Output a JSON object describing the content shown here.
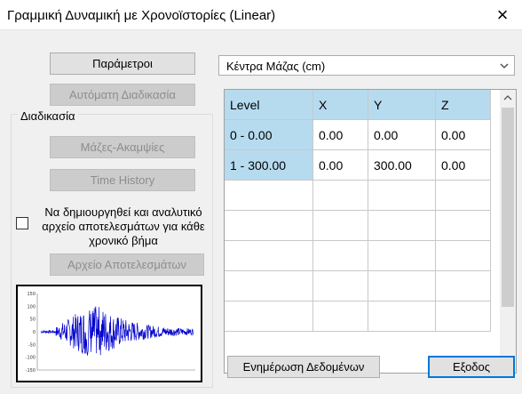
{
  "window": {
    "title": "Γραμμική Δυναμική με Χρονοϊστορίες (Linear)",
    "close_glyph": "×"
  },
  "left_panel": {
    "parameters_label": "Παράμετροι",
    "auto_process_label": "Αυτόματη Διαδικασία",
    "group_label": "Διαδικασία",
    "masses_label": "Μάζες-Ακαμψίες",
    "time_history_label": "Time History",
    "checkbox_label": "Να δημιουργηθεί και αναλυτικό αρχείο αποτελεσμάτων για κάθε χρονικό βήμα",
    "checkbox_checked": false,
    "results_file_label": "Αρχείο Αποτελεσμάτων"
  },
  "combo": {
    "selected": "Κέντρα Μάζας (cm)"
  },
  "grid": {
    "columns": [
      "Level",
      "X",
      "Y",
      "Z"
    ],
    "rows": [
      [
        "0 - 0.00",
        "0.00",
        "0.00",
        "0.00"
      ],
      [
        "1 - 300.00",
        "0.00",
        "300.00",
        "0.00"
      ]
    ],
    "empty_rows": 5
  },
  "bottom": {
    "update_label": "Ενημέρωση Δεδομένων",
    "exit_label": "Εξοδος"
  },
  "chart_data": {
    "type": "line",
    "title": "",
    "xlabel": "",
    "ylabel": "",
    "yticks": [
      "150",
      "100",
      "50",
      "0",
      "-50",
      "-100",
      "-150"
    ],
    "ylim": [
      -150,
      150
    ],
    "color": "#0000cc"
  },
  "icons": {
    "close": "close-icon",
    "combo_arrow": "chevron-down-icon",
    "scroll_up": "chevron-up-icon",
    "scroll_down": "chevron-down-icon"
  }
}
